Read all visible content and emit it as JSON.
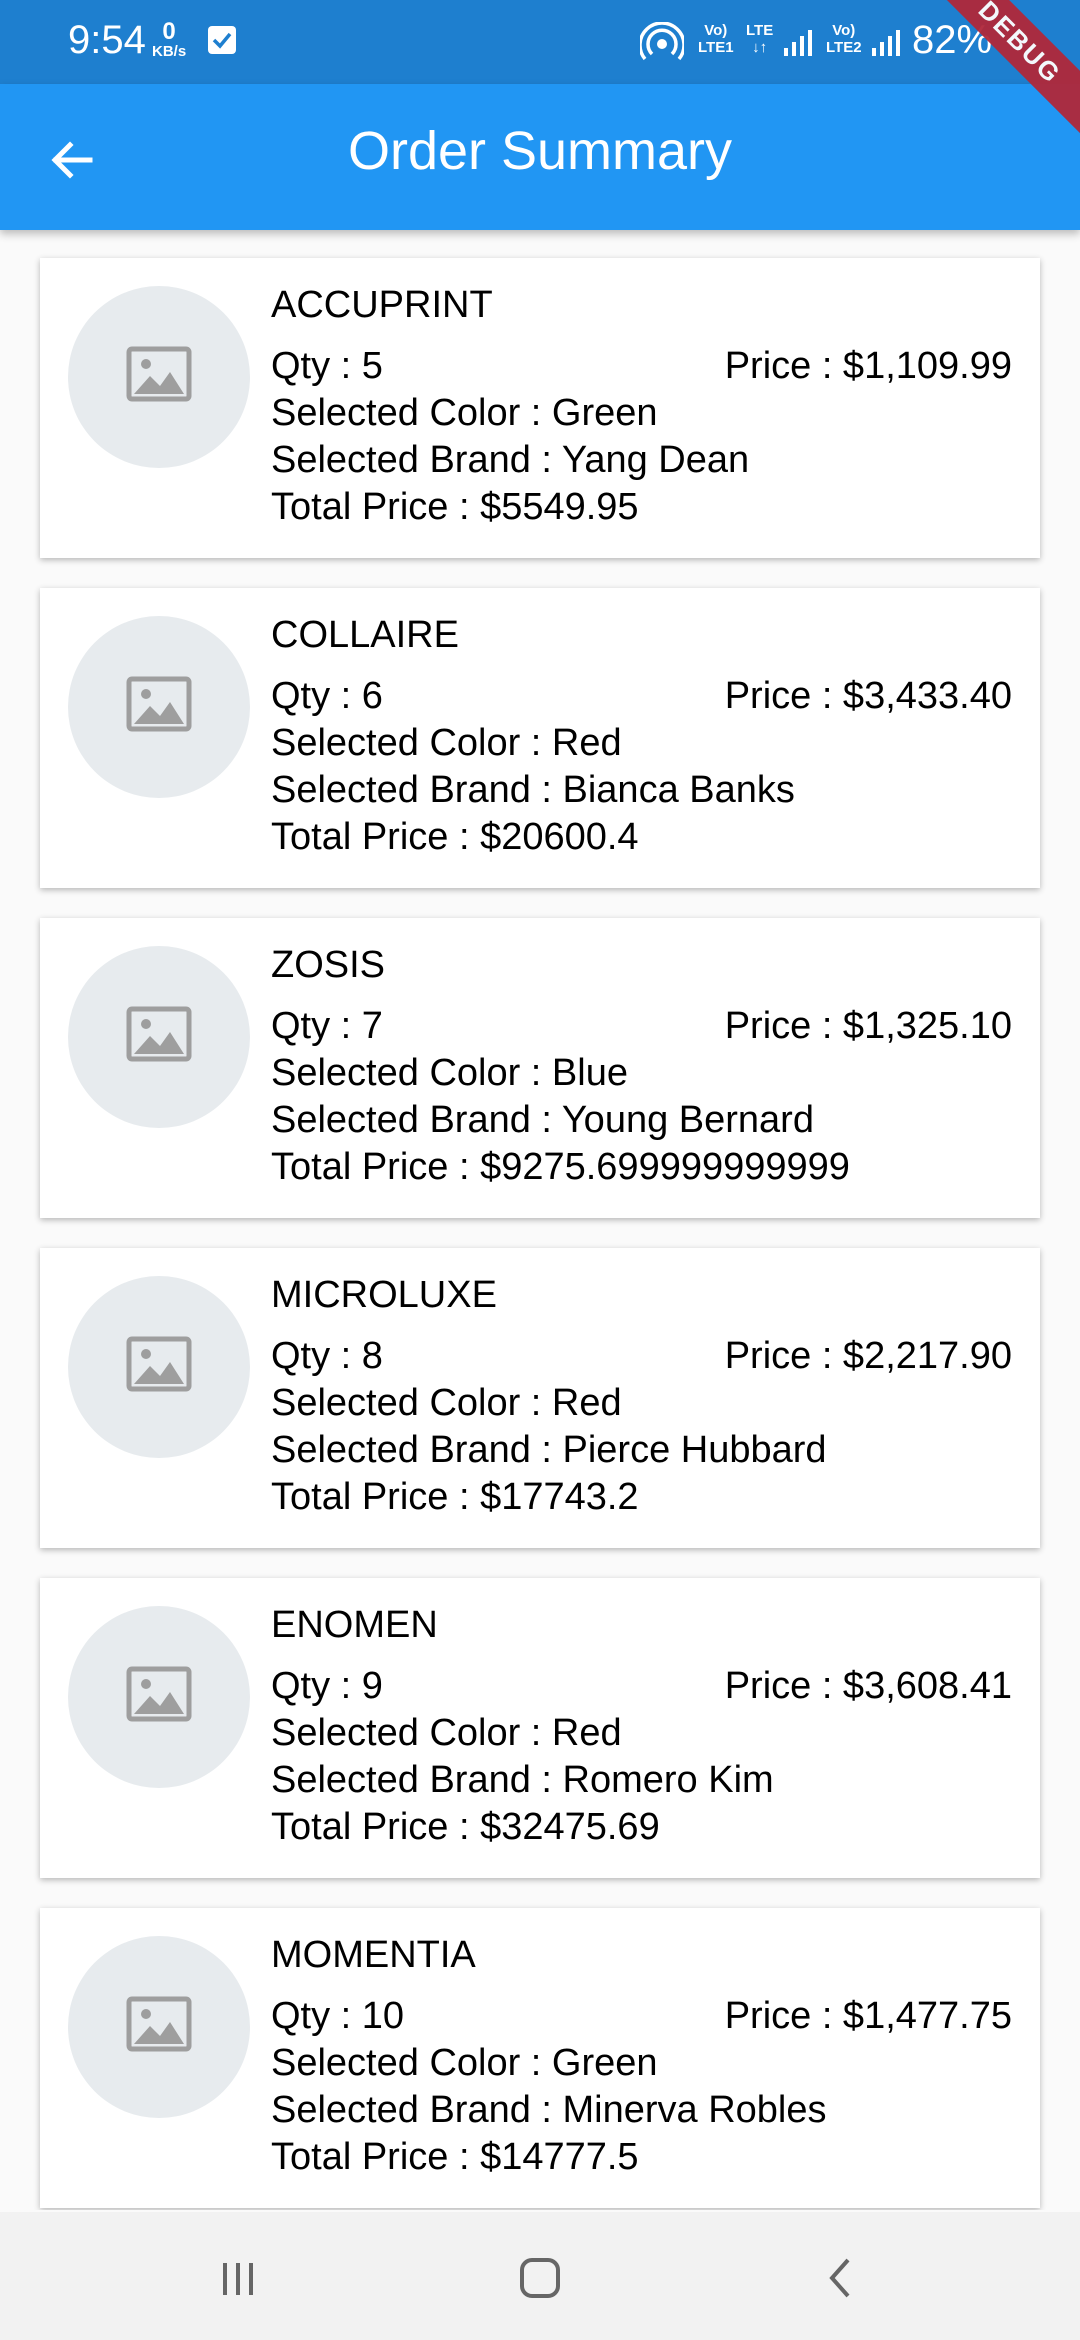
{
  "status_bar": {
    "time": "9:54",
    "net_speed_value": "0",
    "net_speed_unit": "KB/s",
    "volte1": "Vo)",
    "lte1": "LTE1",
    "lte_label": "LTE",
    "volte2": "Vo)",
    "lte2": "LTE2",
    "battery": "82%"
  },
  "debug_banner": "DEBUG",
  "app_bar": {
    "title": "Order Summary"
  },
  "orders": [
    {
      "name": "ACCUPRINT",
      "qty": "Qty : 5",
      "price": "Price : $1,109.99",
      "color": "Selected Color : Green",
      "brand": "Selected Brand : Yang Dean",
      "total": "Total Price : $5549.95"
    },
    {
      "name": "COLLAIRE",
      "qty": "Qty : 6",
      "price": "Price : $3,433.40",
      "color": "Selected Color : Red",
      "brand": "Selected Brand : Bianca Banks",
      "total": "Total Price : $20600.4"
    },
    {
      "name": "ZOSIS",
      "qty": "Qty : 7",
      "price": "Price : $1,325.10",
      "color": "Selected Color : Blue",
      "brand": "Selected Brand : Young Bernard",
      "total": "Total Price : $9275.699999999999"
    },
    {
      "name": "MICROLUXE",
      "qty": "Qty : 8",
      "price": "Price : $2,217.90",
      "color": "Selected Color : Red",
      "brand": "Selected Brand : Pierce Hubbard",
      "total": "Total Price : $17743.2"
    },
    {
      "name": "ENOMEN",
      "qty": "Qty : 9",
      "price": "Price : $3,608.41",
      "color": "Selected Color : Red",
      "brand": "Selected Brand : Romero Kim",
      "total": "Total Price : $32475.69"
    },
    {
      "name": "MOMENTIA",
      "qty": "Qty : 10",
      "price": "Price : $1,477.75",
      "color": "Selected Color : Green",
      "brand": "Selected Brand : Minerva Robles",
      "total": "Total Price : $14777.5"
    }
  ],
  "nav_bar": {
    "icons": [
      "recent-apps-icon",
      "home-icon",
      "back-icon"
    ]
  },
  "colors": {
    "status_bar": "#1e7fcf",
    "app_bar": "#2196f3",
    "thumb_bg": "#e7ebee",
    "debug": "#b0283a"
  }
}
